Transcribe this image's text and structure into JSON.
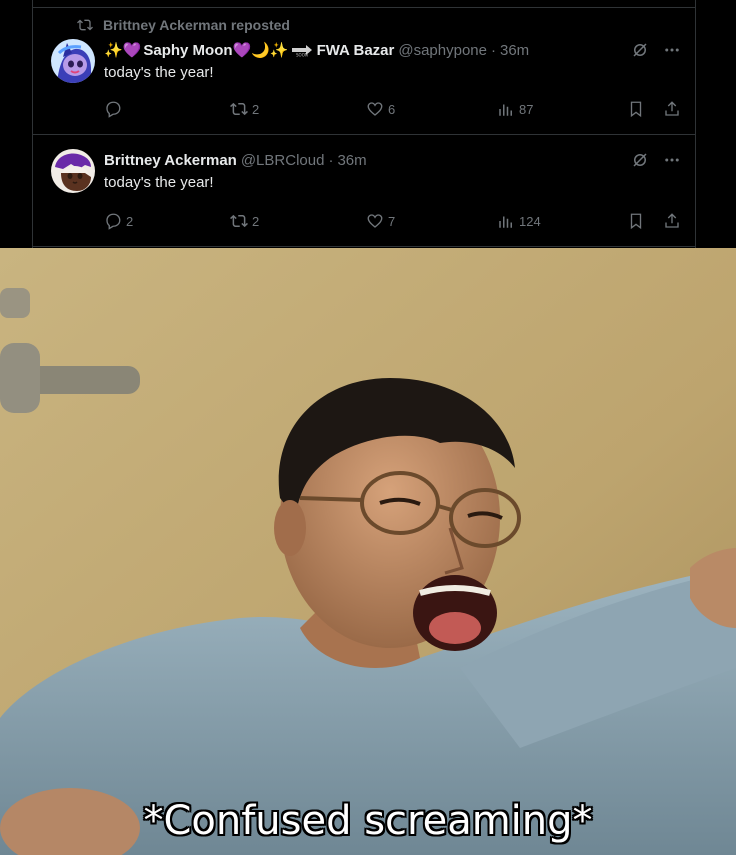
{
  "repost": {
    "label": "Brittney Ackerman reposted"
  },
  "tweets": [
    {
      "display_name": "Saphy Moon",
      "emoji_prefix": "✨💜",
      "emoji_suffix": "💜🌙✨",
      "second_name": "FWA Bazar",
      "handle": "@saphypone",
      "separator": "·",
      "time": "36m",
      "text": "today's the year!",
      "replies": "",
      "reposts": "2",
      "likes": "6",
      "views": "87",
      "avatar_icon": "pony-avatar-icon"
    },
    {
      "display_name": "Brittney Ackerman",
      "handle": "@LBRCloud",
      "separator": "·",
      "time": "36m",
      "text": "today's the year!",
      "replies": "2",
      "reposts": "2",
      "likes": "7",
      "views": "124",
      "avatar_icon": "character-avatar-icon"
    }
  ],
  "meme": {
    "caption": "*Confused screaming*"
  },
  "colors": {
    "background": "#000000",
    "text_primary": "#e7e9ea",
    "text_secondary": "#71767b",
    "border": "#2f3336",
    "meme_wall": "#c7b27a",
    "shirt": "#8fa8b6"
  }
}
